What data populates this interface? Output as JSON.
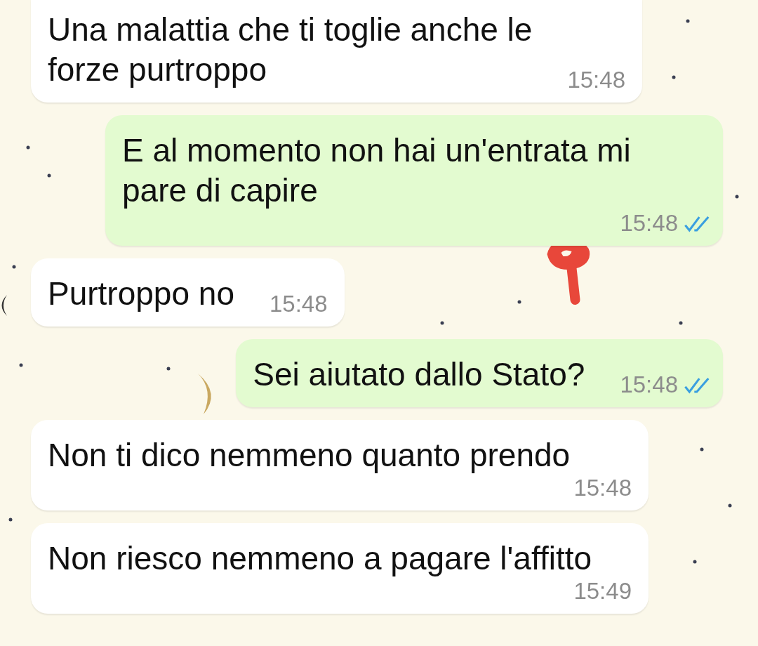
{
  "messages": [
    {
      "kind": "received",
      "text": "Una malattia che ti toglie anche le\nforze purtroppo",
      "time": "15:48"
    },
    {
      "kind": "sent",
      "text": "E al momento non hai un'entrata mi\npare di capire",
      "time": "15:48",
      "read": true
    },
    {
      "kind": "received",
      "text": "Purtroppo no",
      "time": "15:48"
    },
    {
      "kind": "sent",
      "text": "Sei aiutato dallo Stato?",
      "time": "15:48",
      "read": true
    },
    {
      "kind": "received",
      "text": "Non ti dico nemmeno quanto prendo",
      "time": "15:48"
    },
    {
      "kind": "received",
      "text": "Non riesco nemmeno a pagare l'affitto",
      "time": "15:49"
    }
  ]
}
